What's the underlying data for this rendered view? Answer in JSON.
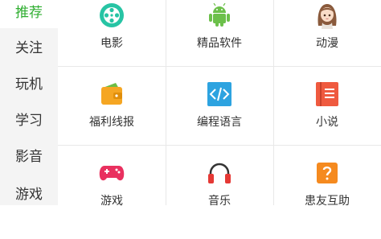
{
  "sidebar": {
    "items": [
      {
        "label": "推荐",
        "active": true
      },
      {
        "label": "关注",
        "active": false
      },
      {
        "label": "玩机",
        "active": false
      },
      {
        "label": "学习",
        "active": false
      },
      {
        "label": "影音",
        "active": false
      },
      {
        "label": "游戏",
        "active": false
      }
    ]
  },
  "grid": {
    "items": [
      {
        "label": "电影",
        "icon": "film-reel-icon"
      },
      {
        "label": "精品软件",
        "icon": "android-icon"
      },
      {
        "label": "动漫",
        "icon": "anime-girl-icon"
      },
      {
        "label": "福利线报",
        "icon": "wallet-icon"
      },
      {
        "label": "编程语言",
        "icon": "code-icon"
      },
      {
        "label": "小说",
        "icon": "book-icon"
      },
      {
        "label": "游戏",
        "icon": "gamepad-icon"
      },
      {
        "label": "音乐",
        "icon": "headphones-icon"
      },
      {
        "label": "患友互助",
        "icon": "question-icon"
      }
    ]
  },
  "colors": {
    "accent": "#2fae30",
    "sidebar_bg": "#f4f4f4",
    "divider": "#e8e8e8"
  }
}
